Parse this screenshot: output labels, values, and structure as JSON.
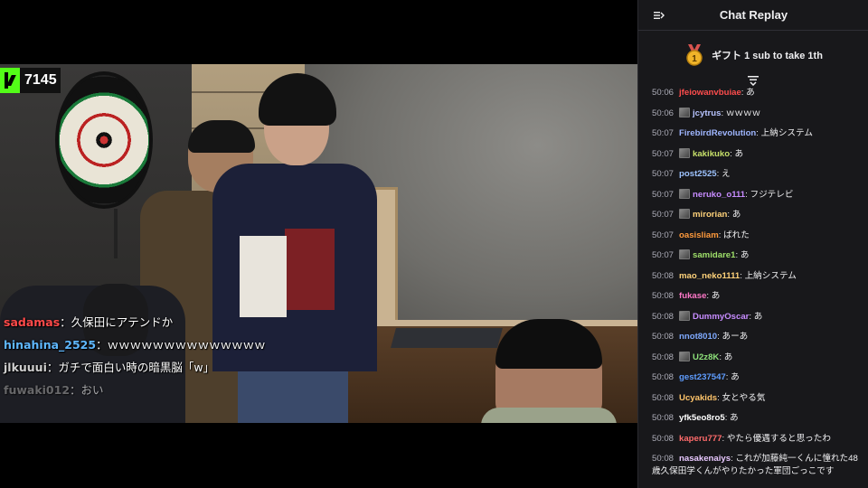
{
  "viewer": {
    "count": "7145"
  },
  "overlay_chat": [
    {
      "user": "sadamas",
      "sep": "：",
      "text": "久保田にアテンドか",
      "color": "#ff4a4a"
    },
    {
      "user": "hinahina_2525",
      "sep": "：",
      "text": "ｗｗｗｗｗｗｗｗｗｗｗｗｗｗ",
      "color": "#5fb8ff"
    },
    {
      "user": "jlkuuui",
      "sep": "：",
      "text": "ガチで面白い時の暗黒脳「w」",
      "color": "#cfcfcf"
    },
    {
      "user": "fuwaki012",
      "sep": "：",
      "text": "おい",
      "color": "#9a9a9a"
    }
  ],
  "chat": {
    "title": "Chat Replay",
    "gift_text": "ギフト 1 sub to take 1th",
    "messages": [
      {
        "time": "50:06",
        "user": "jfeiowanvbuiae",
        "badge": false,
        "text": "あ",
        "color": "#ff4d4d"
      },
      {
        "time": "50:06",
        "user": "jcytrus",
        "badge": true,
        "text": "ｗｗｗｗ",
        "color": "#b8c4ff"
      },
      {
        "time": "50:07",
        "user": "FirebirdRevolution",
        "badge": false,
        "text": "上納システム",
        "color": "#9fb6ff"
      },
      {
        "time": "50:07",
        "user": "kakikuko",
        "badge": true,
        "text": "あ",
        "color": "#c7e06a"
      },
      {
        "time": "50:07",
        "user": "post2525",
        "badge": false,
        "text": "え",
        "color": "#9ec3ff"
      },
      {
        "time": "50:07",
        "user": "neruko_o111",
        "badge": true,
        "text": "フジテレビ",
        "color": "#c78cff"
      },
      {
        "time": "50:07",
        "user": "mirorian",
        "badge": true,
        "text": "あ",
        "color": "#ffd27a"
      },
      {
        "time": "50:07",
        "user": "oasisliam",
        "badge": false,
        "text": "ばれた",
        "color": "#ff9a3c"
      },
      {
        "time": "50:07",
        "user": "samidare1",
        "badge": true,
        "text": "あ",
        "color": "#9fe06a"
      },
      {
        "time": "50:08",
        "user": "mao_neko1111",
        "badge": false,
        "text": "上納システム",
        "color": "#ffd27a"
      },
      {
        "time": "50:08",
        "user": "fukase",
        "badge": false,
        "text": "あ",
        "color": "#ff77c8"
      },
      {
        "time": "50:08",
        "user": "DummyOscar",
        "badge": true,
        "text": "あ",
        "color": "#c78cff"
      },
      {
        "time": "50:08",
        "user": "nnot8010",
        "badge": false,
        "text": "あーあ",
        "color": "#7faaff"
      },
      {
        "time": "50:08",
        "user": "U2z8K",
        "badge": true,
        "text": "あ",
        "color": "#8de07a"
      },
      {
        "time": "50:08",
        "user": "gest237547",
        "badge": false,
        "text": "あ",
        "color": "#5f9dff"
      },
      {
        "time": "50:08",
        "user": "Ucyakids",
        "badge": false,
        "text": "女とやる気",
        "color": "#ffc46a"
      },
      {
        "time": "50:08",
        "user": "yfk5eo8ro5",
        "badge": false,
        "text": "あ",
        "color": "#ffffff"
      },
      {
        "time": "50:08",
        "user": "kaperu777",
        "badge": false,
        "text": "やたら優遇すると思ったわ",
        "color": "#ff6b6b"
      },
      {
        "time": "50:08",
        "user": "nasakenaiys",
        "badge": false,
        "text": "これが加藤純一くんに憧れた48歳久保田学くんがやりたかった軍団ごっこです",
        "color": "#e8c8ff"
      }
    ]
  }
}
